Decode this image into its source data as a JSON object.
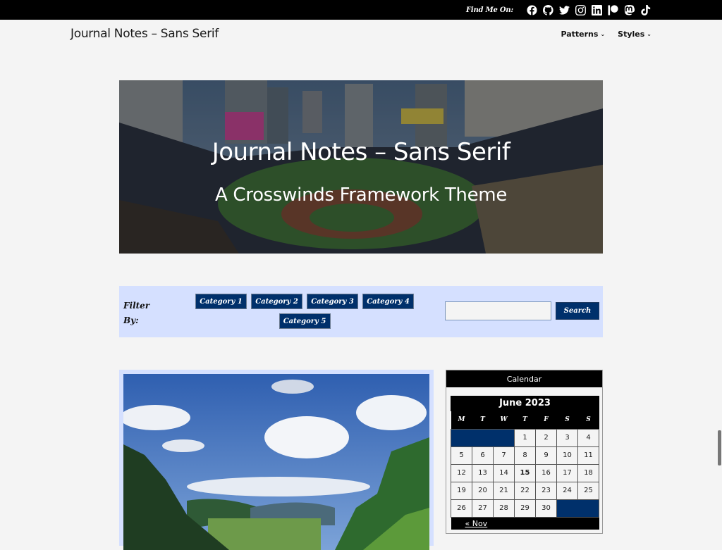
{
  "topbar": {
    "find_label": "Find Me On:",
    "social_icons": [
      "facebook-icon",
      "github-icon",
      "twitter-icon",
      "instagram-icon",
      "linkedin-icon",
      "patreon-icon",
      "mastodon-icon",
      "tiktok-icon"
    ]
  },
  "header": {
    "site_title": "Journal Notes – Sans Serif",
    "nav": [
      {
        "label": "Patterns",
        "icon": "chevron-down-icon"
      },
      {
        "label": "Styles",
        "icon": "chevron-down-icon"
      }
    ]
  },
  "hero": {
    "title": "Journal Notes – Sans Serif",
    "subtitle": "A Crosswinds Framework Theme",
    "image": "baseball-stadium-photo"
  },
  "filter": {
    "label": "Filter By:",
    "categories": [
      "Category 1",
      "Category 2",
      "Category 3",
      "Category 4",
      "Category 5"
    ],
    "search_value": "",
    "search_button": "Search"
  },
  "post": {
    "image": "mountain-valley-landscape-photo"
  },
  "calendar": {
    "widget_title": "Calendar",
    "caption": "June 2023",
    "weekdays": [
      "M",
      "T",
      "W",
      "T",
      "F",
      "S",
      "S"
    ],
    "leading_blanks": 3,
    "days": 30,
    "today": 15,
    "prev_link": "« Nov"
  },
  "colors": {
    "accent": "#00306b",
    "filter_bg": "#d5e0ff",
    "page_bg": "#f4f4f4"
  }
}
